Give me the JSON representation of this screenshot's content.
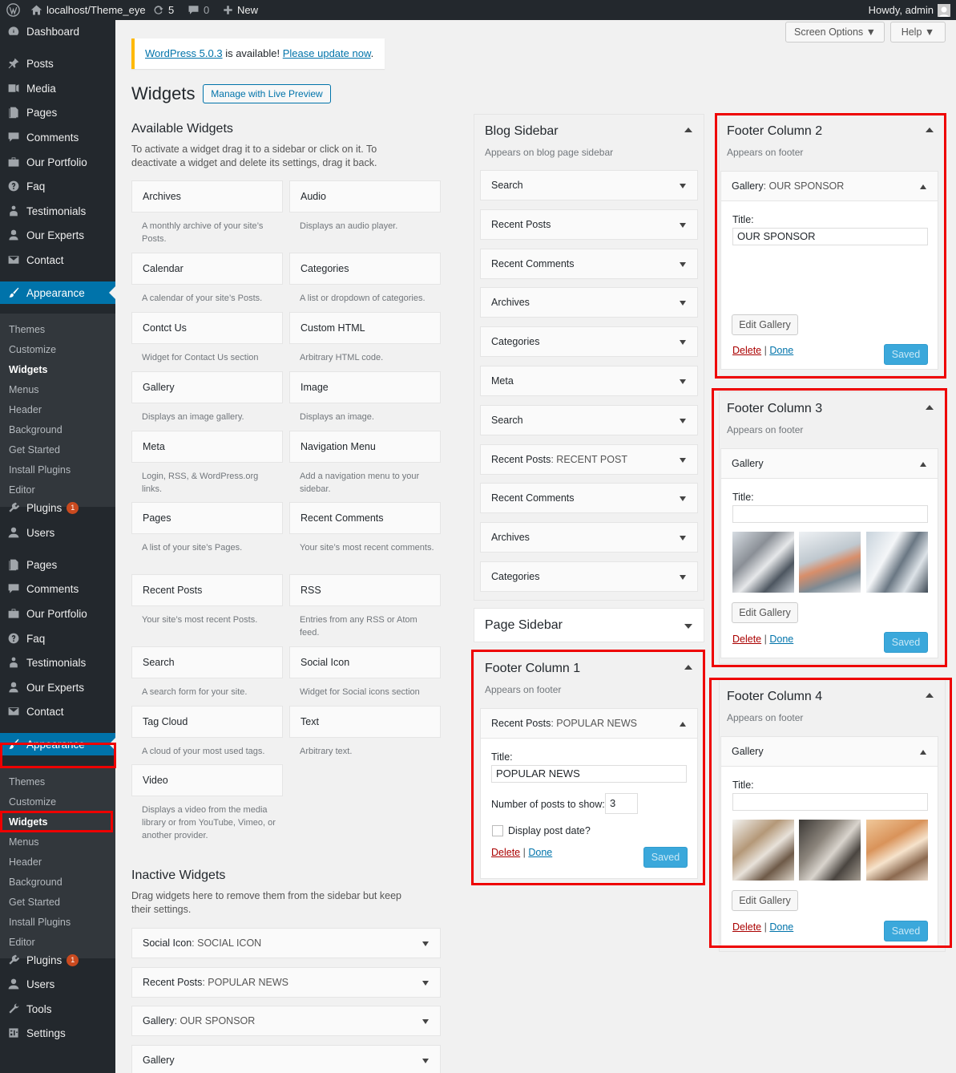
{
  "adminbar": {
    "site": "localhost/Theme_eye",
    "updates": "5",
    "comments": "0",
    "new": "New",
    "howdy": "Howdy, admin"
  },
  "menu": [
    {
      "label": "Dashboard",
      "icon": "dashboard-icon"
    },
    {
      "label": "Posts",
      "icon": "pin-icon"
    },
    {
      "label": "Media",
      "icon": "media-icon"
    },
    {
      "label": "Pages",
      "icon": "page-icon"
    },
    {
      "label": "Comments",
      "icon": "comment-icon"
    },
    {
      "label": "Our Portfolio",
      "icon": "portfolio-icon"
    },
    {
      "label": "Faq",
      "icon": "help-icon"
    },
    {
      "label": "Testimonials",
      "icon": "people-icon"
    },
    {
      "label": "Our Experts",
      "icon": "expert-icon"
    },
    {
      "label": "Contact",
      "icon": "mail-icon"
    },
    {
      "label": "Appearance",
      "icon": "brush-icon"
    },
    {
      "label": "Plugins",
      "icon": "plugin-icon"
    },
    {
      "label": "Users",
      "icon": "user-icon"
    },
    {
      "label": "Pages",
      "icon": "page-icon"
    },
    {
      "label": "Comments",
      "icon": "comment-icon"
    },
    {
      "label": "Our Portfolio",
      "icon": "portfolio-icon"
    },
    {
      "label": "Faq",
      "icon": "help-icon"
    },
    {
      "label": "Testimonials",
      "icon": "people-icon"
    },
    {
      "label": "Our Experts",
      "icon": "expert-icon"
    },
    {
      "label": "Contact",
      "icon": "mail-icon"
    },
    {
      "label": "Appearance",
      "icon": "brush-icon"
    },
    {
      "label": "Plugins",
      "icon": "plugin-icon"
    },
    {
      "label": "Users",
      "icon": "user-icon"
    },
    {
      "label": "Tools",
      "icon": "wrench-icon"
    },
    {
      "label": "Settings",
      "icon": "settings-icon"
    }
  ],
  "plugins_badge": "1",
  "submenu": [
    "Themes",
    "Customize",
    "Widgets",
    "Menus",
    "Header",
    "Background",
    "Get Started",
    "Install Plugins",
    "Editor"
  ],
  "top_buttons": {
    "screen_options": "Screen Options",
    "help": "Help"
  },
  "notice": {
    "version_link": "WordPress 5.0.3",
    "mid": " is available! ",
    "update_link": "Please update now",
    "end": "."
  },
  "page_title": "Widgets",
  "manage_button": "Manage with Live Preview",
  "available": {
    "title": "Available Widgets",
    "desc": "To activate a widget drag it to a sidebar or click on it. To deactivate a widget and delete its settings, drag it back.",
    "widgets": [
      {
        "name": "Archives",
        "desc": "A monthly archive of your site’s Posts."
      },
      {
        "name": "Audio",
        "desc": "Displays an audio player."
      },
      {
        "name": "Calendar",
        "desc": "A calendar of your site’s Posts."
      },
      {
        "name": "Categories",
        "desc": "A list or dropdown of categories."
      },
      {
        "name": "Contct Us",
        "desc": "Widget for Contact Us section"
      },
      {
        "name": "Custom HTML",
        "desc": "Arbitrary HTML code."
      },
      {
        "name": "Gallery",
        "desc": "Displays an image gallery."
      },
      {
        "name": "Image",
        "desc": "Displays an image."
      },
      {
        "name": "Meta",
        "desc": "Login, RSS, & WordPress.org links."
      },
      {
        "name": "Navigation Menu",
        "desc": "Add a navigation menu to your sidebar."
      },
      {
        "name": "Pages",
        "desc": "A list of your site’s Pages."
      },
      {
        "name": "Recent Comments",
        "desc": "Your site’s most recent comments."
      },
      {
        "name": "Recent Posts",
        "desc": "Your site’s most recent Posts."
      },
      {
        "name": "RSS",
        "desc": "Entries from any RSS or Atom feed."
      },
      {
        "name": "Search",
        "desc": "A search form for your site."
      },
      {
        "name": "Social Icon",
        "desc": "Widget for Social icons section"
      },
      {
        "name": "Tag Cloud",
        "desc": "A cloud of your most used tags."
      },
      {
        "name": "Text",
        "desc": "Arbitrary text."
      },
      {
        "name": "Video",
        "desc": "Displays a video from the media library or from YouTube, Vimeo, or another provider."
      }
    ]
  },
  "inactive": {
    "title": "Inactive Widgets",
    "desc": "Drag widgets here to remove them from the sidebar but keep their settings.",
    "widgets": [
      {
        "type": "Social Icon",
        "title": ": SOCIAL ICON"
      },
      {
        "type": "Recent Posts",
        "title": ": POPULAR NEWS"
      },
      {
        "type": "Gallery",
        "title": ": OUR SPONSOR"
      },
      {
        "type": "Gallery",
        "title": ""
      }
    ]
  },
  "blog_sidebar": {
    "title": "Blog Sidebar",
    "desc": "Appears on blog page sidebar",
    "widgets": [
      {
        "type": "Search",
        "title": ""
      },
      {
        "type": "Recent Posts",
        "title": ""
      },
      {
        "type": "Recent Comments",
        "title": ""
      },
      {
        "type": "Archives",
        "title": ""
      },
      {
        "type": "Categories",
        "title": ""
      },
      {
        "type": "Meta",
        "title": ""
      },
      {
        "type": "Search",
        "title": ""
      },
      {
        "type": "Recent Posts",
        "title": ": RECENT POST"
      },
      {
        "type": "Recent Comments",
        "title": ""
      },
      {
        "type": "Archives",
        "title": ""
      },
      {
        "type": "Categories",
        "title": ""
      }
    ]
  },
  "page_sidebar": {
    "title": "Page Sidebar"
  },
  "footer1": {
    "title": "Footer Column 1",
    "desc": "Appears on footer",
    "widget_type": "Recent Posts",
    "widget_title": ": POPULAR NEWS",
    "title_label": "Title:",
    "title_value": "POPULAR NEWS",
    "num_label": "Number of posts to show:",
    "num_value": "3",
    "date_label": "Display post date?"
  },
  "footer2": {
    "title": "Footer Column 2",
    "desc": "Appears on footer",
    "widget_type": "Gallery",
    "widget_title": ": OUR SPONSOR",
    "title_label": "Title:",
    "title_value": "OUR SPONSOR"
  },
  "footer3": {
    "title": "Footer Column 3",
    "desc": "Appears on footer",
    "widget_type": "Gallery",
    "widget_title": "",
    "title_label": "Title:",
    "title_value": ""
  },
  "footer4": {
    "title": "Footer Column 4",
    "desc": "Appears on footer",
    "widget_type": "Gallery",
    "widget_title": "",
    "title_label": "Title:",
    "title_value": ""
  },
  "labels": {
    "edit_gallery": "Edit Gallery",
    "delete": "Delete",
    "sep": " | ",
    "done": "Done",
    "saved": "Saved"
  },
  "colors": {
    "accent": "#0073aa",
    "highlight": "#e00000",
    "adminbar": "#23282d",
    "saved": "#3ba8db"
  }
}
